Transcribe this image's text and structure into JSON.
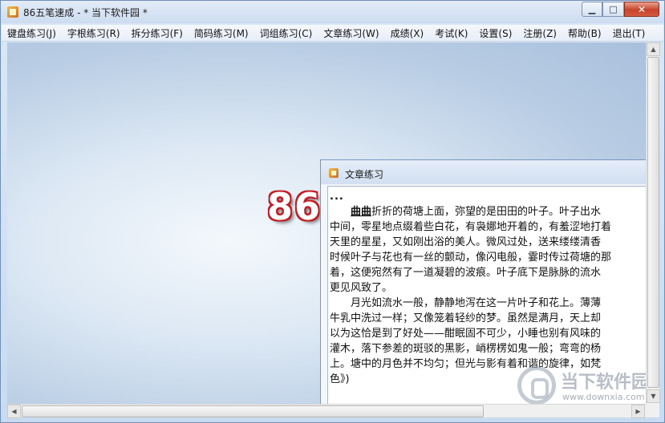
{
  "window": {
    "title": "86五笔速成 - * 当下软件园 *",
    "minimize_glyph": "▁",
    "maximize_glyph": "□",
    "close_glyph": "✕"
  },
  "menu": {
    "items": [
      {
        "label": "键盘练习(J)"
      },
      {
        "label": "字根练习(R)"
      },
      {
        "label": "拆分练习(F)"
      },
      {
        "label": "简码练习(M)"
      },
      {
        "label": "词组练习(C)"
      },
      {
        "label": "文章练习(W)"
      },
      {
        "label": "成绩(X)"
      },
      {
        "label": "考试(K)"
      },
      {
        "label": "设置(S)"
      },
      {
        "label": "注册(Z)"
      },
      {
        "label": "帮助(B)"
      },
      {
        "label": "退出(T)"
      }
    ]
  },
  "background": {
    "logo_text": "86"
  },
  "article_window": {
    "title": "文章练习",
    "marker": "...",
    "highlight": "曲曲",
    "first_line_rest": "折折的荷塘上面，弥望的是田田的叶子。叶子出水",
    "lines": [
      "中间，零星地点缀着些白花，有袅娜地开着的，有羞涩地打着",
      "天里的星星，又如刚出浴的美人。微风过处，送来缕缕清香",
      "时候叶子与花也有一丝的颤动，像闪电般，霎时传过荷塘的那",
      "着，这便宛然有了一道凝碧的波痕。叶子底下是脉脉的流水",
      "更见风致了。",
      "　　月光如流水一般，静静地泻在这一片叶子和花上。薄薄",
      "牛乳中洗过一样；又像笼着轻纱的梦。虽然是满月，天上却",
      "以为这恰是到了好处——酣眠固不可少，小睡也别有风味的",
      "灌木，落下参差的斑驳的黑影，峭楞楞如鬼一般；弯弯的杨",
      "上。塘中的月色并不均匀；但光与影有着和谐的旋律，如梵",
      "色》)"
    ]
  },
  "watermark": {
    "name": "当下软件园",
    "url": "www.downxia.com"
  },
  "scrollbars": {
    "up_arrow": "▲",
    "down_arrow": "▼",
    "left_arrow": "◀",
    "right_arrow": "▶"
  }
}
